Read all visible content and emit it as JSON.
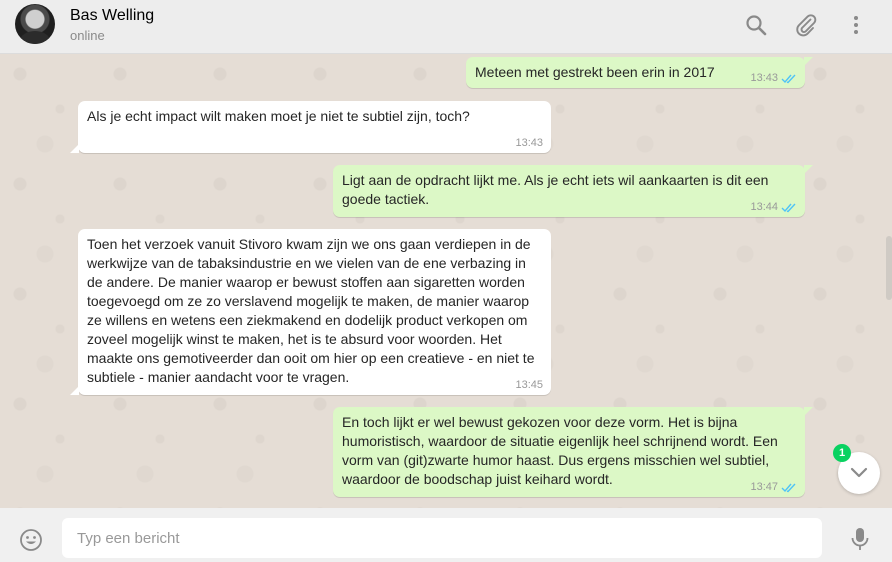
{
  "header": {
    "contact_name": "Bas Welling",
    "contact_status": "online",
    "icons": [
      "search-icon",
      "paperclip-icon",
      "menu-icon"
    ]
  },
  "messages": [
    {
      "direction": "out",
      "text": "Meteen met gestrekt been erin in 2017",
      "time": "13:43",
      "status": "read"
    },
    {
      "direction": "in",
      "text": "Als je echt impact wilt maken moet je niet te subtiel zijn, toch?",
      "time": "13:43"
    },
    {
      "direction": "out",
      "text": "Ligt aan de opdracht lijkt me. Als je echt iets wil aankaarten is dit een goede tactiek.",
      "time": "13:44",
      "status": "read"
    },
    {
      "direction": "in",
      "text": "Toen het verzoek vanuit Stivoro kwam zijn we ons gaan verdiepen in de werkwijze van de tabaksindustrie en we vielen van de ene verbazing in de andere. De manier waarop er bewust stoffen aan sigaretten worden toegevoegd om ze zo verslavend mogelijk te maken, de manier waarop ze willens en wetens een ziekmakend en dodelijk product verkopen om zoveel mogelijk winst te maken, het is te absurd voor woorden. Het maakte ons gemotiveerder dan ooit om hier op een creatieve - en niet te subtiele - manier aandacht voor te vragen.",
      "time": "13:45"
    },
    {
      "direction": "out",
      "text": "En toch lijkt er wel bewust gekozen voor deze vorm. Het is bijna humoristisch, waardoor de situatie eigenlijk heel schrijnend wordt. Een vorm van (git)zwarte humor haast. Dus ergens misschien wel subtiel, waardoor de boodschap juist keihard wordt.",
      "time": "13:47",
      "status": "read"
    }
  ],
  "scroll_button": {
    "unread_count": "1",
    "icon": "chevron-down-icon"
  },
  "composer": {
    "placeholder": "Typ een bericht",
    "value": "",
    "icons": [
      "emoji-icon",
      "microphone-icon"
    ]
  },
  "colors": {
    "outgoing_bubble": "#dcf8c6",
    "incoming_bubble": "#ffffff",
    "chat_background": "#e5ddd5",
    "read_ticks": "#4fc3f7",
    "unread_badge": "#09d261"
  }
}
